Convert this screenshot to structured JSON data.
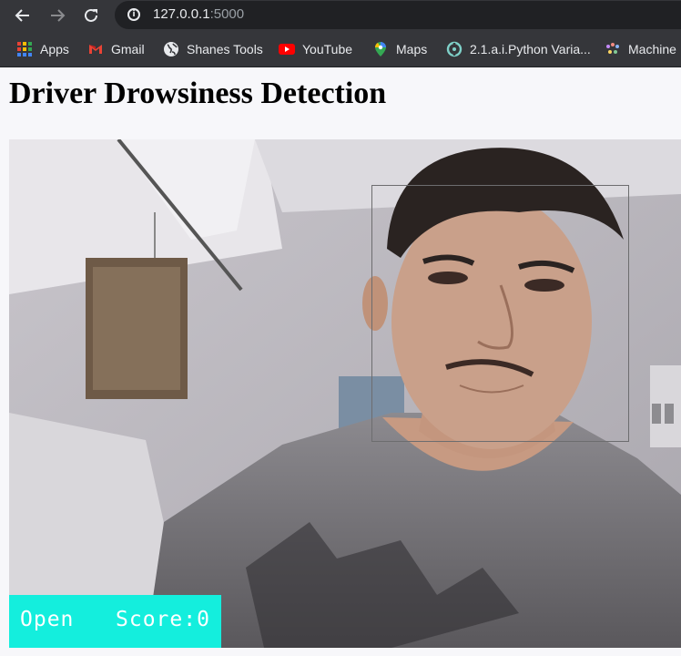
{
  "browser": {
    "url_host": "127.0.0.1",
    "url_port": ":5000",
    "bookmarks": [
      {
        "label": "Apps",
        "icon": "apps-grid-icon"
      },
      {
        "label": "Gmail",
        "icon": "gmail-icon"
      },
      {
        "label": "Shanes Tools",
        "icon": "globe-icon"
      },
      {
        "label": "YouTube",
        "icon": "youtube-icon"
      },
      {
        "label": "Maps",
        "icon": "maps-pin-icon"
      },
      {
        "label": "2.1.a.i.Python Varia...",
        "icon": "python-course-icon"
      },
      {
        "label": "Machine",
        "icon": "machine-learning-icon"
      }
    ]
  },
  "page": {
    "title": "Driver Drowsiness Detection"
  },
  "overlay": {
    "eye_state": "Open",
    "score_text": "Score:0",
    "accent": "#14eedd"
  }
}
